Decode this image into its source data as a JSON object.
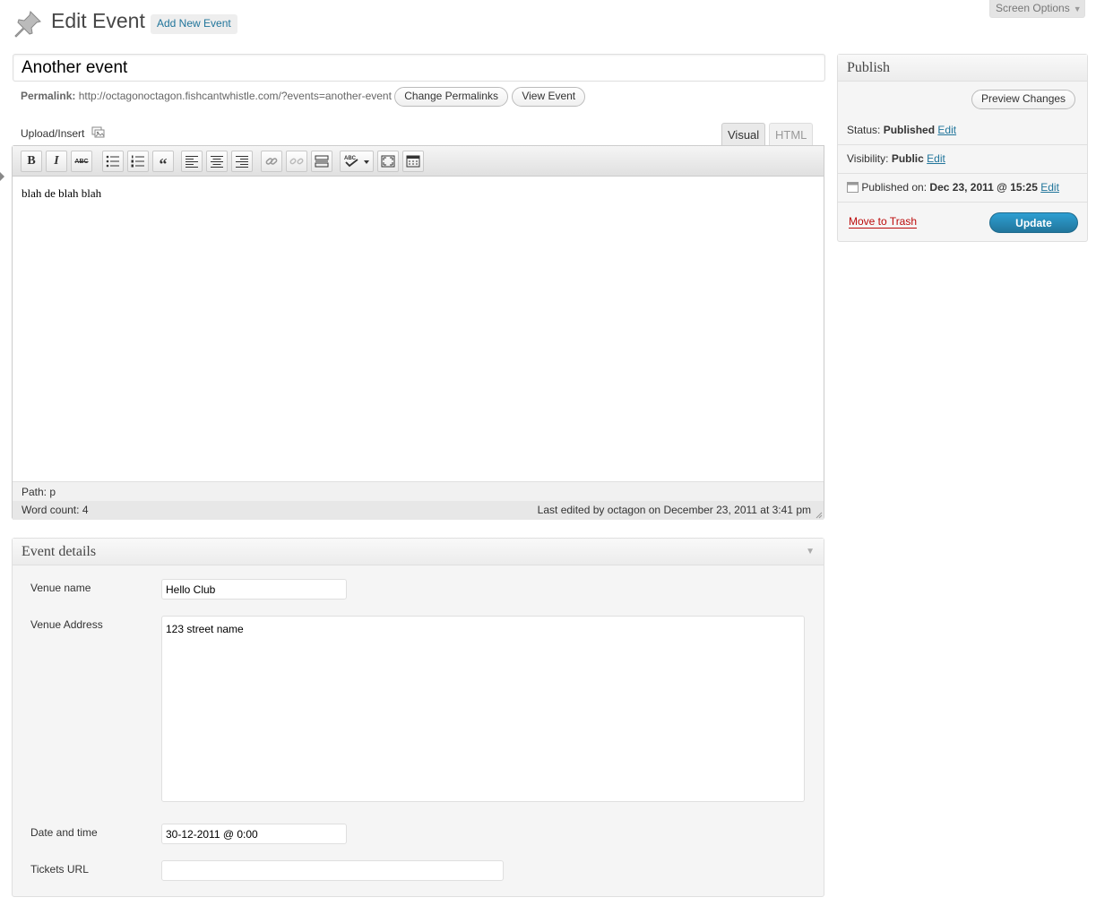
{
  "header": {
    "page_title": "Edit Event",
    "add_new_label": "Add New Event",
    "screen_options_label": "Screen Options"
  },
  "post": {
    "title": "Another event",
    "permalink_label": "Permalink:",
    "permalink_url": "http://octagonoctagon.fishcantwhistle.com/?events=another-event",
    "change_permalinks_label": "Change Permalinks",
    "view_event_label": "View Event"
  },
  "editor": {
    "upload_insert_label": "Upload/Insert",
    "tab_visual": "Visual",
    "tab_html": "HTML",
    "content": "blah de blah blah",
    "path_label": "Path:",
    "path_value": "p",
    "word_count_label": "Word count:",
    "word_count": "4",
    "last_edited": "Last edited by octagon on December 23, 2011 at 3:41 pm"
  },
  "publish": {
    "title": "Publish",
    "preview_label": "Preview Changes",
    "status_label": "Status:",
    "status_value": "Published",
    "visibility_label": "Visibility:",
    "visibility_value": "Public",
    "published_on_label": "Published on:",
    "published_on_value": "Dec 23, 2011 @ 15:25",
    "edit_label": "Edit",
    "trash_label": "Move to Trash",
    "update_label": "Update"
  },
  "event_details": {
    "title": "Event details",
    "venue_name_label": "Venue name",
    "venue_name_value": "Hello Club",
    "venue_address_label": "Venue Address",
    "venue_address_value": "123 street name",
    "date_time_label": "Date and time",
    "date_time_value": "30-12-2011 @ 0:00",
    "tickets_url_label": "Tickets URL",
    "tickets_url_value": ""
  },
  "colors": {
    "link": "#21759b",
    "trash": "#bc0b0b",
    "update_button": "#21759b"
  }
}
